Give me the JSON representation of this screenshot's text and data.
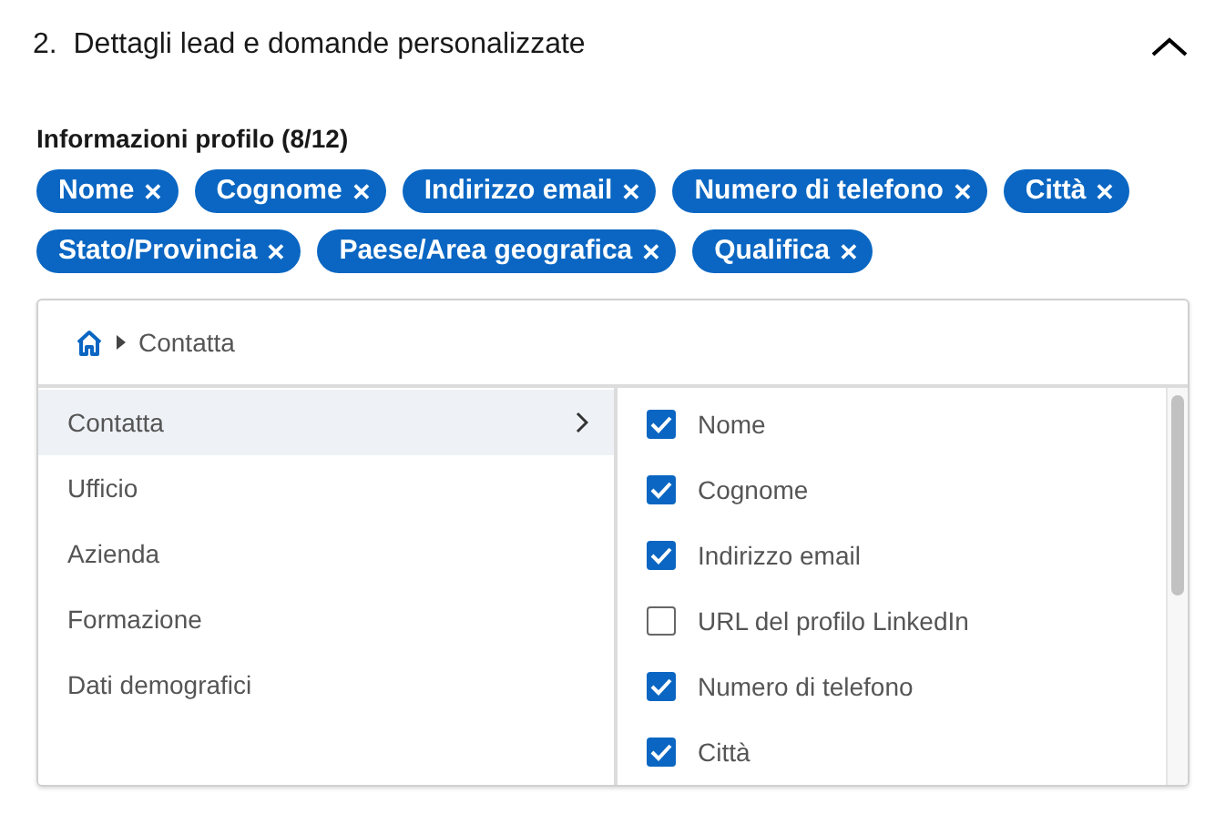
{
  "section": {
    "number": "2.",
    "title": "Dettagli lead e domande personalizzate",
    "expanded": true
  },
  "profile_info": {
    "label": "Informazioni profilo (8/12)",
    "tags": [
      {
        "label": "Nome",
        "remove": "✕"
      },
      {
        "label": "Cognome",
        "remove": "✕"
      },
      {
        "label": "Indirizzo email",
        "remove": "✕"
      },
      {
        "label": "Numero di telefono",
        "remove": "✕"
      },
      {
        "label": "Città",
        "remove": "✕"
      },
      {
        "label": "Stato/Provincia",
        "remove": "✕"
      },
      {
        "label": "Paese/Area geografica",
        "remove": "✕"
      },
      {
        "label": "Qualifica",
        "remove": "✕"
      }
    ]
  },
  "picker": {
    "breadcrumb": "Contatta",
    "categories": [
      {
        "label": "Contatta",
        "selected": true
      },
      {
        "label": "Ufficio",
        "selected": false
      },
      {
        "label": "Azienda",
        "selected": false
      },
      {
        "label": "Formazione",
        "selected": false
      },
      {
        "label": "Dati demografici",
        "selected": false
      }
    ],
    "fields": [
      {
        "label": "Nome",
        "checked": true
      },
      {
        "label": "Cognome",
        "checked": true
      },
      {
        "label": "Indirizzo email",
        "checked": true
      },
      {
        "label": "URL del profilo LinkedIn",
        "checked": false
      },
      {
        "label": "Numero di telefono",
        "checked": true
      },
      {
        "label": "Città",
        "checked": true
      }
    ]
  }
}
